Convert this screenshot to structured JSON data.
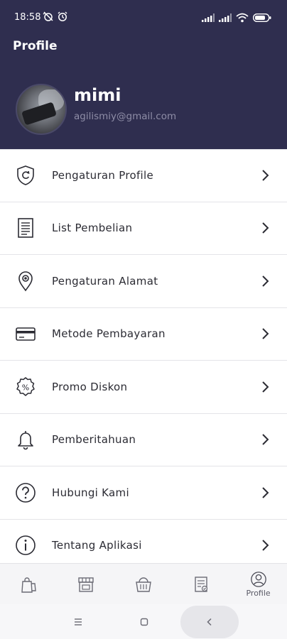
{
  "status_bar": {
    "time": "18:58",
    "left_icons": [
      "alarm-off-icon",
      "alarm-clock-icon"
    ],
    "right_icons": [
      "signal-icon",
      "signal-icon",
      "wifi-icon",
      "battery-icon"
    ],
    "battery": "80"
  },
  "header": {
    "title": "Profile"
  },
  "user": {
    "name": "mimi",
    "email": "agilismiy@gmail.com"
  },
  "menu": {
    "items": [
      {
        "label": "Pengaturan Profile",
        "icon": "shield-refresh-icon"
      },
      {
        "label": "List Pembelian",
        "icon": "receipt-list-icon"
      },
      {
        "label": "Pengaturan Alamat",
        "icon": "location-pin-icon"
      },
      {
        "label": "Metode Pembayaran",
        "icon": "credit-card-icon"
      },
      {
        "label": "Promo Diskon",
        "icon": "discount-badge-icon"
      },
      {
        "label": "Pemberitahuan",
        "icon": "bell-icon"
      },
      {
        "label": "Hubungi Kami",
        "icon": "help-circle-icon"
      },
      {
        "label": "Tentang Aplikasi",
        "icon": "info-circle-icon"
      }
    ]
  },
  "bottom_nav": {
    "items": [
      {
        "icon": "shopping-bags-icon",
        "label": ""
      },
      {
        "icon": "store-icon",
        "label": ""
      },
      {
        "icon": "basket-icon",
        "label": ""
      },
      {
        "icon": "order-list-icon",
        "label": ""
      },
      {
        "icon": "profile-user-icon",
        "label": "Profile"
      }
    ],
    "active_index": 4
  },
  "colors": {
    "header_bg": "#2f2e4f",
    "text_primary": "#2b2b33",
    "email_text": "#8e8da6"
  }
}
